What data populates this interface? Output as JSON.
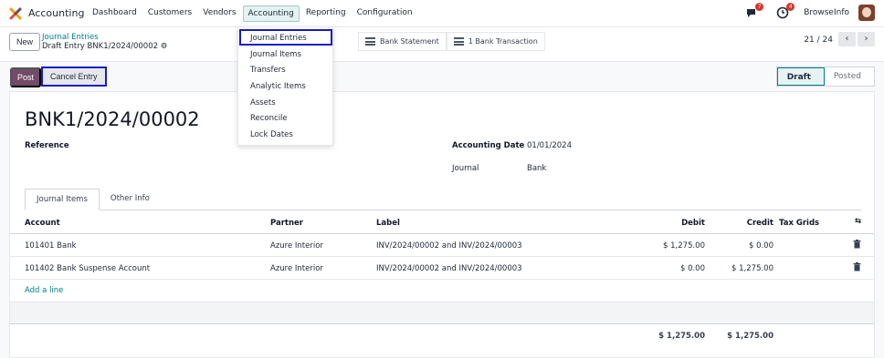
{
  "nav": {
    "app_name": "Accounting",
    "menu": [
      "Dashboard",
      "Customers",
      "Vendors",
      "Accounting",
      "Reporting",
      "Configuration"
    ],
    "messages_badge": "7",
    "activity_badge": "4",
    "company": "BrowseInfo"
  },
  "control": {
    "new_label": "New",
    "breadcrumb_parent": "Journal Entries",
    "breadcrumb_current": "Draft Entry BNK1/2024/00002",
    "smart_buttons": [
      "Bank Statement",
      "1 Bank Transaction"
    ],
    "pager": "21 / 24"
  },
  "status": {
    "post_label": "Post",
    "cancel_label": "Cancel Entry",
    "stages": [
      "Draft",
      "Posted"
    ]
  },
  "form": {
    "title": "BNK1/2024/00002",
    "reference_label": "Reference",
    "accounting_date_label": "Accounting Date",
    "accounting_date": "01/01/2024",
    "journal_label": "Journal",
    "journal": "Bank",
    "tabs": [
      "Journal Items",
      "Other Info"
    ]
  },
  "table": {
    "headers": [
      "Account",
      "Partner",
      "Label",
      "Debit",
      "Credit",
      "Tax Grids"
    ],
    "rows": [
      {
        "account": "101401 Bank",
        "partner": "Azure Interior",
        "label": "INV/2024/00002 and INV/2024/00003",
        "debit": "$ 1,275.00",
        "credit": "$ 0.00"
      },
      {
        "account": "101402 Bank Suspense Account",
        "partner": "Azure Interior",
        "label": "INV/2024/00002 and INV/2024/00003",
        "debit": "$ 0.00",
        "credit": "$ 1,275.00"
      }
    ],
    "add_line": "Add a line",
    "total_debit": "$ 1,275.00",
    "total_credit": "$ 1,275.00"
  },
  "dropdown": {
    "items": [
      "Journal Entries",
      "Journal Items",
      "Transfers",
      "Analytic Items",
      "Assets",
      "Reconcile",
      "Lock Dates"
    ]
  }
}
